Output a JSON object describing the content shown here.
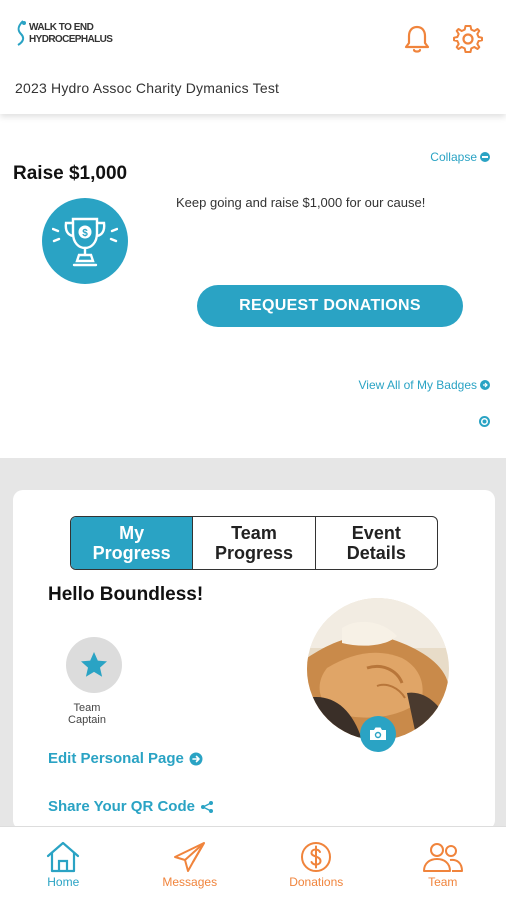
{
  "header": {
    "logo_line1": "WALK TO END",
    "logo_line2": "HYDROCEPHALUS",
    "event_title": "2023 Hydro Assoc Charity Dymanics Test",
    "icons": [
      "bell-icon",
      "gear-icon"
    ]
  },
  "badge_card": {
    "collapse_label": "Collapse",
    "title": "Raise $1,000",
    "message": "Keep going and raise $1,000 for our cause!",
    "request_button": "REQUEST DONATIONS",
    "view_badges_label": "View All of My Badges"
  },
  "progress_card": {
    "tabs": [
      {
        "line1": "My",
        "line2": "Progress",
        "active": true
      },
      {
        "line1": "Team",
        "line2": "Progress",
        "active": false
      },
      {
        "line1": "Event",
        "line2": "Details",
        "active": false
      }
    ],
    "greeting": "Hello Boundless!",
    "role_line1": "Team",
    "role_line2": "Captain",
    "edit_page_label": "Edit Personal Page",
    "share_qr_label": "Share Your QR Code"
  },
  "nav": {
    "items": [
      {
        "label": "Home",
        "icon": "home-icon",
        "active": true
      },
      {
        "label": "Messages",
        "icon": "paper-plane-icon",
        "active": false
      },
      {
        "label": "Donations",
        "icon": "dollar-icon",
        "active": false
      },
      {
        "label": "Team",
        "icon": "people-icon",
        "active": false
      }
    ]
  },
  "colors": {
    "accent_blue": "#2aa3c4",
    "accent_orange": "#f0843c",
    "background_gray": "#e6e6e6"
  }
}
